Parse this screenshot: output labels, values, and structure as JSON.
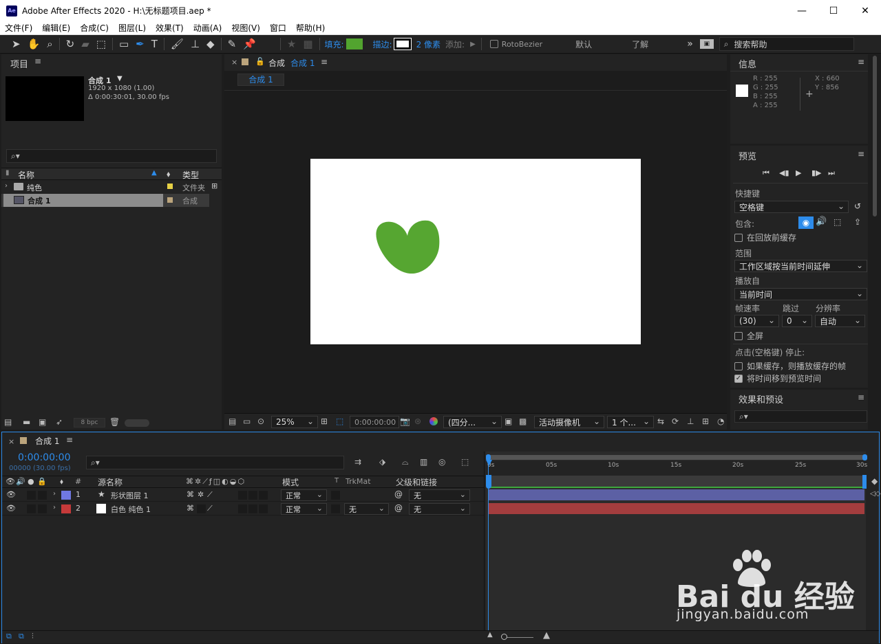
{
  "window": {
    "title": "Adobe After Effects 2020 - H:\\无标题项目.aep *",
    "app_icon": "Ae"
  },
  "menu": [
    "文件(F)",
    "编辑(E)",
    "合成(C)",
    "图层(L)",
    "效果(T)",
    "动画(A)",
    "视图(V)",
    "窗口",
    "帮助(H)"
  ],
  "toolbar": {
    "fill_label": "填充:",
    "stroke_label": "描边:",
    "stroke_width": "2 像素",
    "add_label": "添加:",
    "rotobezier": "RotoBezier",
    "workspace": "默认",
    "learn": "了解",
    "search_placeholder": "搜索帮助",
    "fill_color": "#52a42f",
    "stroke_color": "#000000"
  },
  "project": {
    "title": "项目",
    "comp_name": "合成 1",
    "comp_size": "1920 x 1080 (1.00)",
    "comp_duration": "Δ 0:00:30:01, 30.00 fps",
    "col_name": "名称",
    "col_type": "类型",
    "items": [
      {
        "name": "纯色",
        "type": "文件夹",
        "color": "#e6d045"
      },
      {
        "name": "合成 1",
        "type": "合成",
        "color": "#bba47c"
      }
    ],
    "bpc": "8 bpc"
  },
  "composition": {
    "tab_label": "合成",
    "tab_comp": "合成 1",
    "subtab": "合成 1",
    "heart_color": "#56a631",
    "zoom": "25%",
    "timecode": "0:00:00:00",
    "resolution": "(四分...",
    "camera": "活动摄像机",
    "views": "1 个..."
  },
  "info": {
    "title": "信息",
    "r": "R : 255",
    "g": "G : 255",
    "b": "B : 255",
    "a": "A : 255",
    "x": "X : 660",
    "y": "Y : 856"
  },
  "preview": {
    "title": "预览",
    "shortcut_label": "快捷键",
    "shortcut_value": "空格键",
    "include_label": "包含:",
    "cache_before": "在回放前缓存",
    "range_label": "范围",
    "range_value": "工作区域按当前时间延伸",
    "play_from_label": "播放自",
    "play_from_value": "当前时间",
    "fps_label": "帧速率",
    "skip_label": "跳过",
    "res_label": "分辨率",
    "fps_value": "(30)",
    "skip_value": "0",
    "res_value": "自动",
    "fullscreen": "全屏",
    "stop_label": "点击(空格键) 停止:",
    "opt_cache": "如果缓存，则播放缓存的帧",
    "opt_move": "将时间移到预览时间"
  },
  "effects": {
    "title": "效果和预设"
  },
  "timeline": {
    "tab": "合成 1",
    "timecode": "0:00:00:00",
    "fps_note": "00000 (30.00 fps)",
    "col_num": "#",
    "col_source": "源名称",
    "col_mode": "模式",
    "col_t": "T",
    "col_trkmat": "TrkMat",
    "col_parent": "父级和链接",
    "ruler": [
      "0s",
      "05s",
      "10s",
      "15s",
      "20s",
      "25s",
      "30s"
    ],
    "layers": [
      {
        "num": "1",
        "name": "形状图层 1",
        "label_color": "#7078e2",
        "mode": "正常",
        "trkmat": "",
        "parent": "无",
        "bar_color": "#5c60a4"
      },
      {
        "num": "2",
        "name": "白色 纯色 1",
        "label_color": "#c53a3a",
        "mode": "正常",
        "trkmat": "无",
        "parent": "无",
        "bar_color": "#a33d3e"
      }
    ]
  },
  "watermark": {
    "brand": "Bai du 经验",
    "url": "jingyan.baidu.com"
  }
}
